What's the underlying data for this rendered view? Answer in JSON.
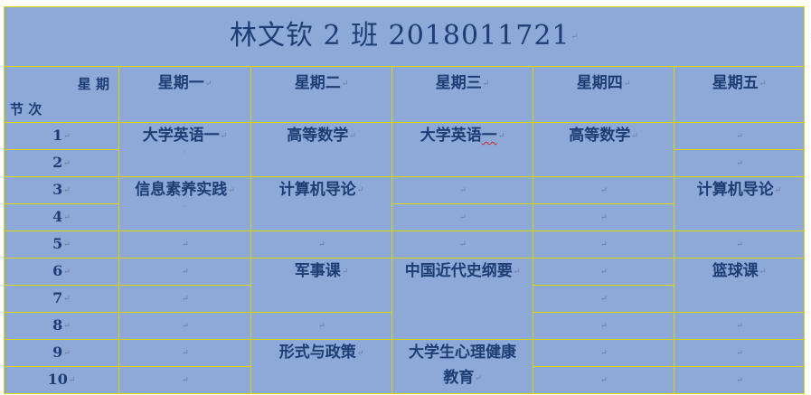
{
  "title": "林文钦   2 班   2018011721",
  "corner": {
    "top": "星 期",
    "bottom": "节 次"
  },
  "days": [
    "星期一",
    "星期二",
    "星期三",
    "星期四",
    "星期五"
  ],
  "periods": [
    "1",
    "2",
    "3",
    "4",
    "5",
    "6",
    "7",
    "8",
    "9",
    "10"
  ],
  "courses": {
    "mon_1_2": "大学英语一",
    "tue_1_2": "高等数学",
    "wed_1_2_a": "大学英语",
    "wed_1_2_b": "一",
    "thu_1_2": "高等数学",
    "mon_3_4": "信息素养实践",
    "tue_3_4": "计算机导论",
    "fri_3_4": "计算机导论",
    "tue_6_7": "军事课",
    "wed_6_8": "中国近代史纲要",
    "fri_6_7": "篮球课",
    "tue_9_10": "形式与政策",
    "wed_9_10_a": "大学生心理健康",
    "wed_9_10_b": "教育"
  },
  "marks": {
    "paragraph": "↵",
    "cell_end": "¤",
    "small": "·"
  }
}
